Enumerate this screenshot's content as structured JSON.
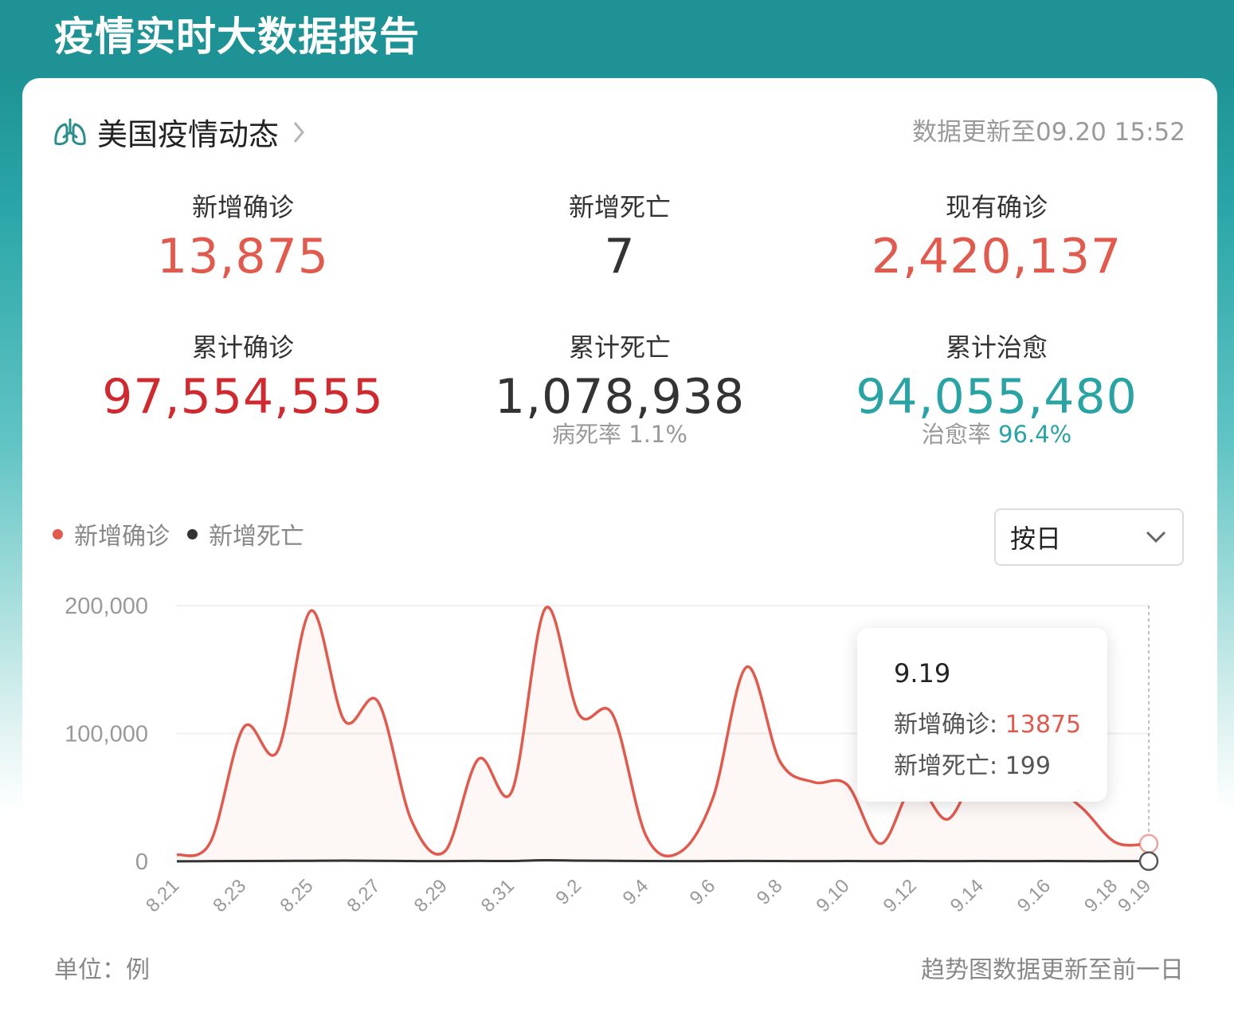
{
  "app": {
    "title": "疫情实时大数据报告"
  },
  "card": {
    "title": "美国疫情动态",
    "update_text": "数据更新至09.20 15:52"
  },
  "stats": [
    {
      "label": "新增确诊",
      "value": "13,875",
      "color": "#e05a4e"
    },
    {
      "label": "新增死亡",
      "value": "7",
      "color": "#333333"
    },
    {
      "label": "现有确诊",
      "value": "2,420,137",
      "color": "#e05a4e"
    },
    {
      "label": "累计确诊",
      "value": "97,554,555",
      "color": "#cf2a2f"
    },
    {
      "label": "累计死亡",
      "value": "1,078,938",
      "color": "#333333",
      "sub_label": "病死率",
      "sub_value": "1.1%"
    },
    {
      "label": "累计治愈",
      "value": "94,055,480",
      "color": "#2aa3a5",
      "sub_label": "治愈率",
      "sub_value": "96.4%"
    }
  ],
  "legend": [
    {
      "name": "新增确诊",
      "color": "#e05a4e"
    },
    {
      "name": "新增死亡",
      "color": "#333333"
    }
  ],
  "select": {
    "value": "按日",
    "icon": "chevron-down-icon"
  },
  "tooltip": {
    "date": "9.19",
    "row1_label": "新增确诊:",
    "row1_value": "13875",
    "row2_label": "新增死亡:",
    "row2_value": "199"
  },
  "footer": {
    "unit": "单位：例",
    "note": "趋势图数据更新至前一日"
  },
  "chart_data": {
    "type": "line",
    "ylim": [
      0,
      200000
    ],
    "yticks": [
      "0",
      "100,000",
      "200,000"
    ],
    "x": [
      "8.21",
      "8.22",
      "8.23",
      "8.24",
      "8.25",
      "8.26",
      "8.27",
      "8.28",
      "8.29",
      "8.30",
      "8.31",
      "9.1",
      "9.2",
      "9.3",
      "9.4",
      "9.5",
      "9.6",
      "9.7",
      "9.8",
      "9.9",
      "9.10",
      "9.11",
      "9.12",
      "9.13",
      "9.14",
      "9.15",
      "9.16",
      "9.17",
      "9.18",
      "9.19"
    ],
    "xtick_labels": [
      "8.21",
      "8.23",
      "8.25",
      "8.27",
      "8.29",
      "8.31",
      "9.2",
      "9.4",
      "9.6",
      "9.8",
      "9.10",
      "9.12",
      "9.14",
      "9.16",
      "9.18",
      "9.19"
    ],
    "series": [
      {
        "name": "新增确诊",
        "color": "#e05a4e",
        "values": [
          5000,
          15000,
          105000,
          86000,
          196000,
          110000,
          125000,
          32000,
          8000,
          80000,
          55000,
          198000,
          115000,
          115000,
          20000,
          7000,
          50000,
          152000,
          78000,
          62000,
          60000,
          13875,
          60000,
          33000,
          75000,
          60000,
          60000,
          42000,
          15000,
          13875
        ]
      },
      {
        "name": "新增死亡",
        "color": "#333333",
        "values": [
          100,
          200,
          300,
          400,
          500,
          600,
          500,
          300,
          200,
          400,
          300,
          900,
          600,
          500,
          300,
          200,
          300,
          400,
          300,
          200,
          300,
          200,
          300,
          200,
          300,
          200,
          300,
          200,
          200,
          199
        ]
      }
    ]
  }
}
